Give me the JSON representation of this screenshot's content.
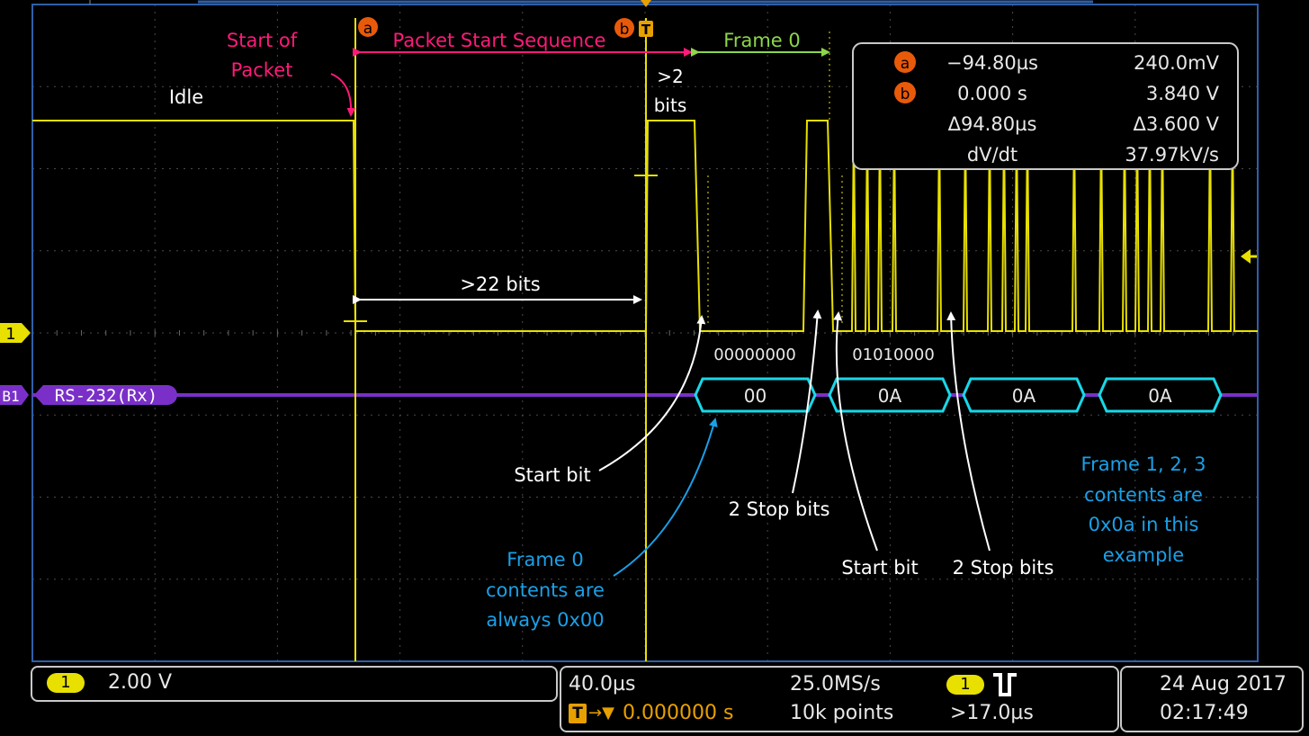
{
  "screen": {
    "colors": {
      "background": "#000000",
      "graticule_border": "#2f5fa8",
      "grid": "#585858",
      "trace_ch1": "#e8e000",
      "bus_b1": "#7a30c8",
      "decode_box": "#18d8e8",
      "annotation_pink": "#ff1a7a",
      "annotation_green": "#8bd64a",
      "annotation_blue": "#1aa0e8",
      "cursor_marker": "#e85a0a",
      "white": "#ffffff"
    }
  },
  "annotations": {
    "start_of_packet": [
      "Start of",
      "Packet"
    ],
    "packet_start_sequence": "Packet Start Sequence",
    "frame0": "Frame 0",
    "idle": "Idle",
    "gt2_bits": [
      ">2",
      "bits"
    ],
    "gt22_bits": ">22 bits",
    "start_bit_1": "Start bit",
    "stop_bits_1": "2 Stop bits",
    "start_bit_2": "Start bit",
    "stop_bits_2": "2 Stop bits",
    "frame0_contents": [
      "Frame 0",
      "contents are",
      "always 0x00"
    ],
    "frames123_contents": [
      "Frame 1, 2, 3",
      "contents are",
      "0x0a in this",
      "example"
    ]
  },
  "markers": {
    "cursor_a": "a",
    "cursor_b": "b",
    "ch1": "1",
    "bus": "B1",
    "bus_label": "RS-232(Rx)"
  },
  "readout": {
    "rows": [
      {
        "marker": "a",
        "time": "−94.80µs",
        "volt": "240.0mV"
      },
      {
        "marker": "b",
        "time": "0.000 s",
        "volt": "3.840 V"
      },
      {
        "marker": "",
        "time": "Δ94.80µs",
        "volt": "Δ3.600 V"
      },
      {
        "marker": "",
        "time": "dV/dt",
        "volt": "37.97kV/s"
      }
    ]
  },
  "bits": {
    "frame0": "00000000",
    "frame1": "01010000"
  },
  "decode": [
    {
      "label": "00"
    },
    {
      "label": "0A"
    },
    {
      "label": "0A"
    },
    {
      "label": "0A"
    }
  ],
  "status": {
    "ch1_badge": "1",
    "ch1_scale": "2.00 V",
    "timebase": "40.0µs",
    "sample_rate": "25.0MS/s",
    "trigger_prefix": "T",
    "trigger_pos": "0.000000 s",
    "record_length": "10k points",
    "trig_badge": "1",
    "trig_condition": ">17.0µs",
    "date": "24 Aug 2017",
    "time": "02:17:49"
  }
}
